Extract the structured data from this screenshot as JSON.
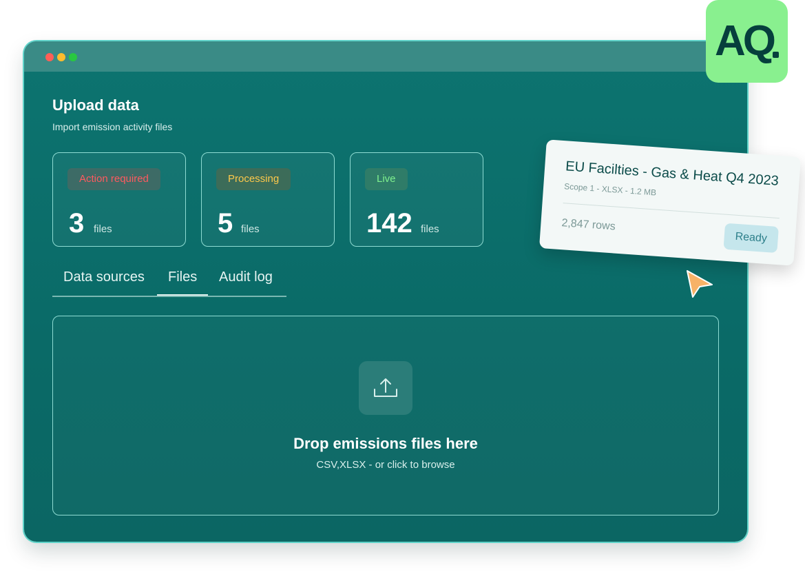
{
  "page": {
    "title": "Upload data",
    "subtitle": "Import emission activity files"
  },
  "stats": [
    {
      "badge": "Action required",
      "count": "3",
      "unit": "files",
      "badge_bg": "#3d6b66",
      "badge_color": "#ff5a5f"
    },
    {
      "badge": "Processing",
      "count": "5",
      "unit": "files",
      "badge_bg": "#3c6c59",
      "badge_color": "#ffc94a"
    },
    {
      "badge": "Live",
      "count": "142",
      "unit": "files",
      "badge_bg": "#2f7c68",
      "badge_color": "#7ff08e"
    }
  ],
  "tabs": [
    {
      "label": "Data sources"
    },
    {
      "label": "Files",
      "active": true
    },
    {
      "label": "Audit log"
    }
  ],
  "dropzone": {
    "icon": "upload-icon",
    "title": "Drop emissions files here",
    "subtitle": "CSV,XLSX - or click to browse"
  },
  "logo": {
    "text": "AQ",
    "bg": "#89f08f"
  },
  "file_card": {
    "title": "EU Facilties - Gas & Heat Q4 2023",
    "meta": "Scope 1 - XLSX - 1.2 MB",
    "rows": "2,847 rows",
    "status": "Ready"
  },
  "colors": {
    "window_bg": "#0b6a67",
    "titlebar": "#3a8b86",
    "accent_green": "#89f08f",
    "cursor": "#f7b267"
  }
}
